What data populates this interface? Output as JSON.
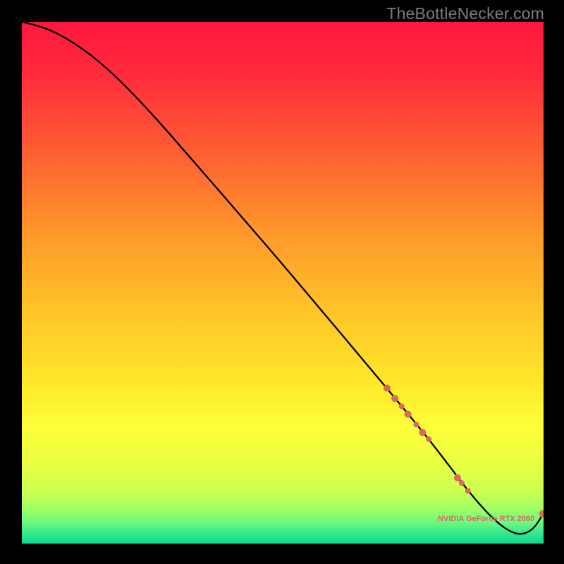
{
  "watermark": "TheBottleNecker.com",
  "gradient": {
    "stops": [
      {
        "offset": 0.0,
        "color": "#ff163f"
      },
      {
        "offset": 0.1,
        "color": "#ff2b3c"
      },
      {
        "offset": 0.25,
        "color": "#ff5e33"
      },
      {
        "offset": 0.4,
        "color": "#ff962b"
      },
      {
        "offset": 0.55,
        "color": "#ffc328"
      },
      {
        "offset": 0.7,
        "color": "#ffea2a"
      },
      {
        "offset": 0.78,
        "color": "#fdff3a"
      },
      {
        "offset": 0.85,
        "color": "#e8ff43"
      },
      {
        "offset": 0.905,
        "color": "#c6ff52"
      },
      {
        "offset": 0.935,
        "color": "#9dff66"
      },
      {
        "offset": 0.96,
        "color": "#6cf97f"
      },
      {
        "offset": 0.98,
        "color": "#34e98e"
      },
      {
        "offset": 1.0,
        "color": "#0fd98e"
      }
    ]
  },
  "chart_data": {
    "type": "line",
    "title": "",
    "xlabel": "",
    "ylabel": "",
    "xlim": [
      0,
      100
    ],
    "ylim": [
      0,
      100
    ],
    "series": [
      {
        "name": "curve",
        "x": [
          0,
          3,
          6,
          10,
          15,
          20,
          26,
          34,
          42,
          50,
          58,
          66,
          73,
          78,
          82,
          85,
          88,
          90.5,
          93,
          95.5,
          98,
          100
        ],
        "y": [
          100,
          99.3,
          98.2,
          96.0,
          92.3,
          87.6,
          81.2,
          72.0,
          62.8,
          53.5,
          44.0,
          34.5,
          26.1,
          20.0,
          14.8,
          10.8,
          7.2,
          4.6,
          2.6,
          1.6,
          2.6,
          5.8
        ]
      }
    ],
    "markers": {
      "color": "#d86a63",
      "points": [
        {
          "x": 70.0,
          "y": 29.8,
          "r": 5
        },
        {
          "x": 71.5,
          "y": 27.8,
          "r": 5
        },
        {
          "x": 72.8,
          "y": 26.3,
          "r": 4
        },
        {
          "x": 74.0,
          "y": 24.8,
          "r": 5
        },
        {
          "x": 75.6,
          "y": 22.8,
          "r": 4
        },
        {
          "x": 76.8,
          "y": 21.3,
          "r": 5
        },
        {
          "x": 78.0,
          "y": 20.0,
          "r": 4
        },
        {
          "x": 83.5,
          "y": 12.6,
          "r": 5
        },
        {
          "x": 84.3,
          "y": 11.6,
          "r": 4
        },
        {
          "x": 85.5,
          "y": 10.1,
          "r": 4
        },
        {
          "x": 99.8,
          "y": 5.7,
          "r": 5
        }
      ]
    },
    "annotation": {
      "text": "NVIDIA GeForce RTX 2060",
      "x": 89.0,
      "y": 4.3
    }
  }
}
